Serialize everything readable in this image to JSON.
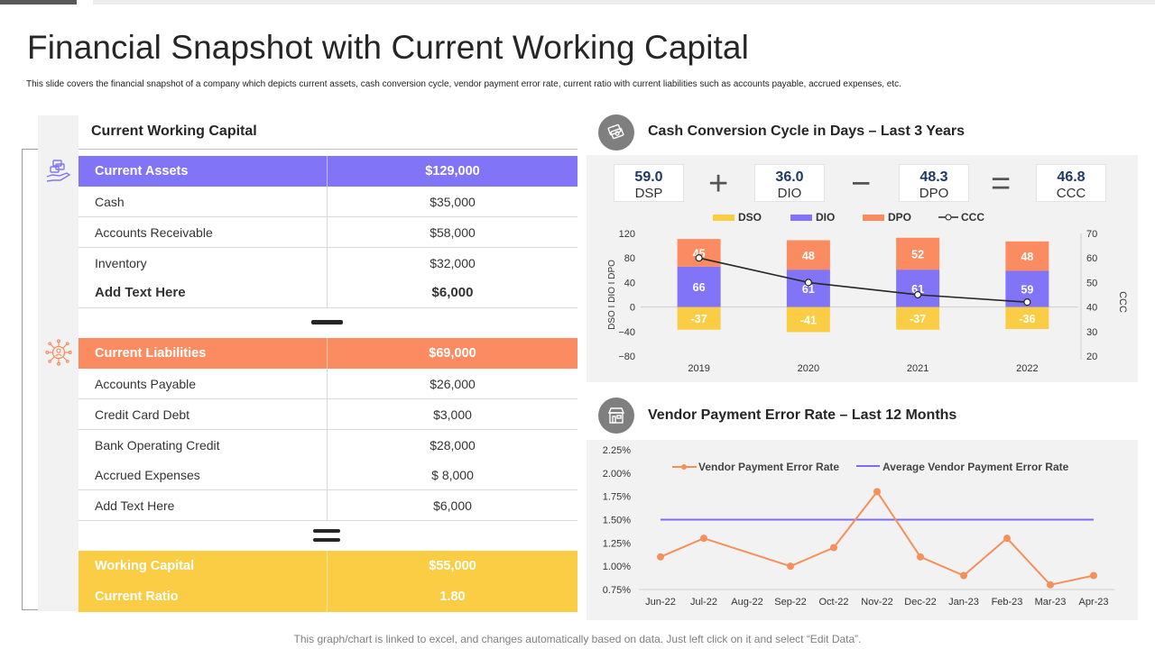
{
  "title": "Financial Snapshot with Current Working Capital",
  "subtitle": "This slide covers the financial snapshot of a company which depicts current assets, cash conversion cycle, vendor payment error rate, current ratio with current liabilities such as accounts payable, accrued expenses, etc.",
  "working_capital": {
    "title": "Current Working Capital",
    "assets_header": {
      "label": "Current Assets",
      "value": "$129,000"
    },
    "assets": [
      {
        "label": "Cash",
        "value": "$35,000"
      },
      {
        "label": "Accounts Receivable",
        "value": "$58,000"
      },
      {
        "label": "Inventory",
        "value": "$32,000"
      },
      {
        "label": "Add  Text Here",
        "value": "$6,000"
      }
    ],
    "liabilities_header": {
      "label": "Current Liabilities",
      "value": "$69,000"
    },
    "liabilities": [
      {
        "label": "Accounts Payable",
        "value": "$26,000"
      },
      {
        "label": "Credit Card  Debt",
        "value": "$3,000"
      },
      {
        "label": "Bank Operating Credit",
        "value": "$28,000"
      },
      {
        "label": "Accrued Expenses",
        "value": "$ 8,000"
      },
      {
        "label": "Add Text Here",
        "value": "$6,000"
      }
    ],
    "working_capital_row": {
      "label": "Working Capital",
      "value": "$55,000"
    },
    "current_ratio_row": {
      "label": "Current Ratio",
      "value": "1.80"
    }
  },
  "ccc_section": {
    "title": "Cash Conversion Cycle in Days – Last 3 Years",
    "kpis": [
      {
        "value": "59.0",
        "label": "DSP"
      },
      {
        "value": "36.0",
        "label": "DIO"
      },
      {
        "value": "48.3",
        "label": "DPO"
      },
      {
        "value": "46.8",
        "label": "CCC"
      }
    ],
    "operators": [
      "+",
      "−",
      "="
    ]
  },
  "vendor_section": {
    "title": "Vendor Payment Error Rate – Last 12 Months"
  },
  "footer": "This graph/chart is linked to excel,  and changes automatically based on data. Just left click on it and select “Edit Data”.",
  "colors": {
    "purple": "#8174f7",
    "orange": "#fb8c62",
    "yellow": "#fbcd45",
    "ccc_line": "#262626",
    "error_line": "#f4905c",
    "average_line": "#7b6cf0"
  },
  "chart_data": [
    {
      "type": "bar",
      "stacked": true,
      "categories": [
        "2019",
        "2020",
        "2021",
        "2022"
      ],
      "series": [
        {
          "name": "DSO",
          "values": [
            -37,
            -41,
            -37,
            -36
          ]
        },
        {
          "name": "DIO",
          "values": [
            66,
            61,
            61,
            59
          ]
        },
        {
          "name": "DPO",
          "values": [
            45,
            48,
            52,
            48
          ]
        },
        {
          "name": "CCC",
          "type": "line",
          "axis": "right",
          "values": [
            60,
            50,
            45,
            42
          ]
        }
      ],
      "ylabel": "DSO I DIO I DPO",
      "y2label": "CCC",
      "ylim": [
        -80,
        120
      ],
      "yticks": [
        -80,
        -40,
        0,
        40,
        80,
        120
      ],
      "ytick_labels": [
        "−80",
        "−40",
        "0",
        "40",
        "80",
        "120"
      ],
      "y2lim": [
        20,
        70
      ],
      "y2ticks": [
        20,
        30,
        40,
        50,
        60,
        70
      ],
      "legend": "top"
    },
    {
      "type": "line",
      "categories": [
        "Jun-22",
        "Jul-22",
        "Aug-22",
        "Sep-22",
        "Oct-22",
        "Nov-22",
        "Dec-22",
        "Jan-23",
        "Feb-23",
        "Mar-23",
        "Apr-23"
      ],
      "series": [
        {
          "name": "Vendor Payment Error Rate",
          "values": [
            1.1,
            1.3,
            null,
            1.0,
            1.2,
            1.8,
            1.1,
            0.9,
            1.3,
            0.8,
            0.9
          ]
        },
        {
          "name": "Average Vendor Payment Error Rate",
          "values": [
            1.5,
            1.5,
            1.5,
            1.5,
            1.5,
            1.5,
            1.5,
            1.5,
            1.5,
            1.5,
            1.5
          ]
        }
      ],
      "yticks": [
        "2.25%",
        "2.00%",
        "1.75%",
        "1.50%",
        "1.25%",
        "1.00%",
        "0.75%"
      ],
      "ylim": [
        0.75,
        2.25
      ],
      "legend": "top"
    }
  ]
}
